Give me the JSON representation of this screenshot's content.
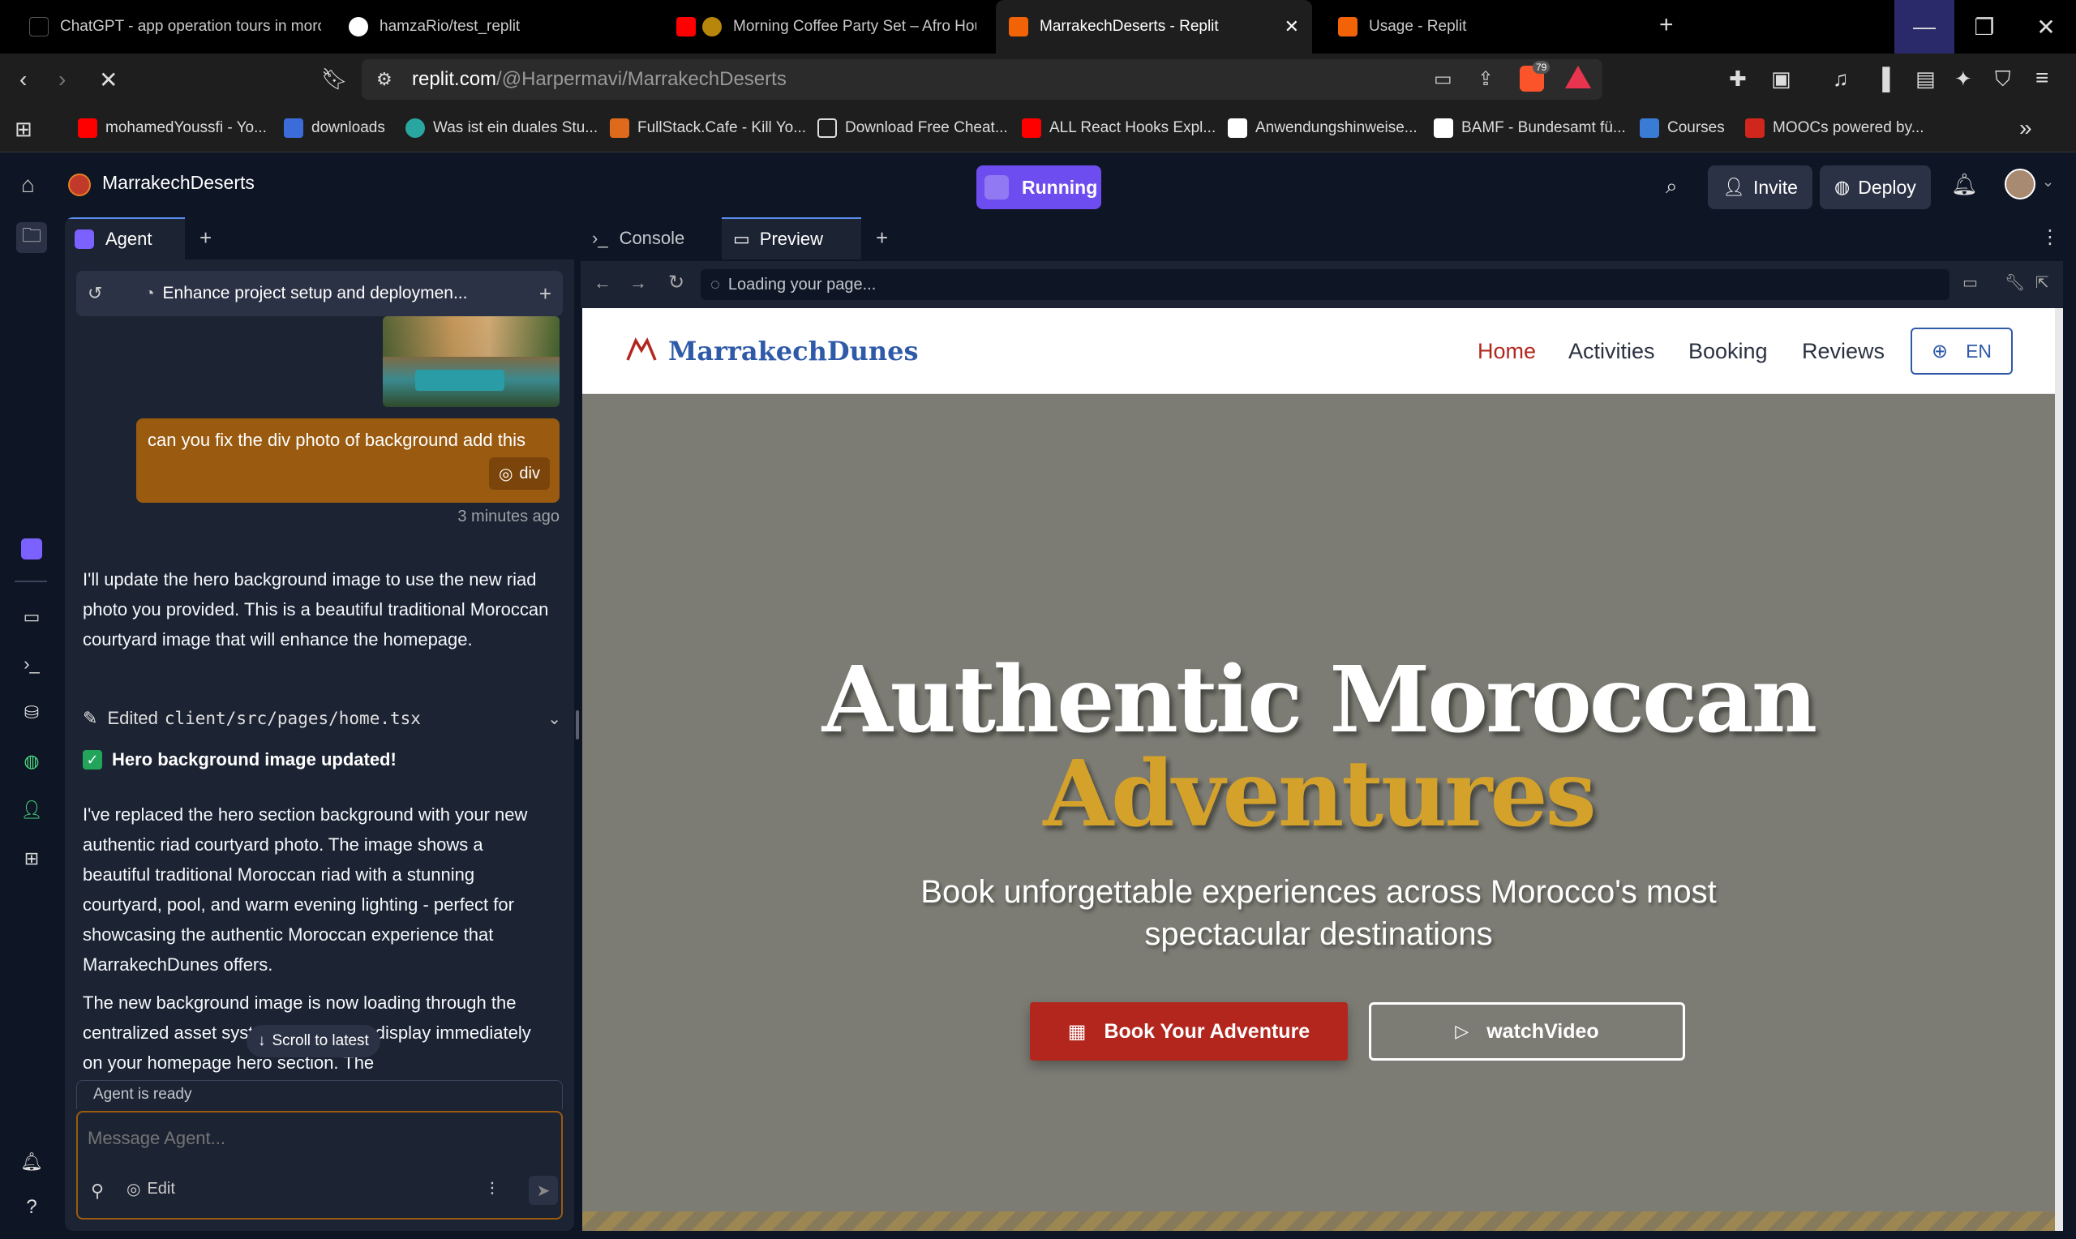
{
  "browser": {
    "tabs": [
      {
        "title": "ChatGPT - app operation tours in morocc",
        "color": "#000000"
      },
      {
        "title": "hamzaRio/test_replit",
        "color": "#ffffff"
      },
      {
        "title": "Morning Coffee Party Set – Afro Hou",
        "color": "#ff0000"
      },
      {
        "title": "MarrakechDeserts - Replit",
        "color": "#f26207"
      },
      {
        "title": "Usage - Replit",
        "color": "#f26207"
      }
    ],
    "url_host": "replit.com",
    "url_path": "/@Harpermavi/MarrakechDeserts",
    "shield_badge": "79",
    "bookmarks": [
      {
        "label": "mohamedYoussfi - Yo...",
        "color": "#ff0000"
      },
      {
        "label": "downloads",
        "color": "#3b6cd9"
      },
      {
        "label": "Was ist ein duales Stu...",
        "color": "#2aa6a1"
      },
      {
        "label": "FullStack.Cafe - Kill Yo...",
        "color": "#e06a1b"
      },
      {
        "label": "Download Free Cheat...",
        "color": "#dddddd"
      },
      {
        "label": "ALL React Hooks Expl...",
        "color": "#ff0000"
      },
      {
        "label": "Anwendungshinweise...",
        "color": "#ffffff"
      },
      {
        "label": "BAMF - Bundesamt fü...",
        "color": "#ffffff"
      },
      {
        "label": "Courses",
        "color": "#3a7bd5"
      },
      {
        "label": "MOOCs powered by...",
        "color": "#d0261c"
      }
    ]
  },
  "replit": {
    "project_name": "MarrakechDeserts",
    "status": "Running",
    "invite_label": "Invite",
    "deploy_label": "Deploy",
    "agent_tab": "Agent",
    "task_title": "Enhance project setup and deploymen...",
    "user_message": "can you fix the div photo of background add this",
    "user_chip": "div",
    "user_time": "3 minutes ago",
    "agent_msg_1": "I'll update the hero background image to use the new riad photo you provided. This is a beautiful traditional Moroccan courtyard image that will enhance the homepage.",
    "edited_label": "Edited",
    "edited_file": "client/src/pages/home.tsx",
    "check_title": "Hero background image updated!",
    "agent_msg_2": "I've replaced the hero section background with your new authentic riad courtyard photo. The image shows a beautiful traditional Moroccan riad with a stunning courtyard, pool, and warm evening lighting - perfect for showcasing the authentic Moroccan experience that MarrakechDunes offers.",
    "agent_msg_3": "The new background image is now loading through the centralized asset system and should display immediately on your homepage hero section. The",
    "scroll_latest": "Scroll to latest",
    "agent_status": "Agent is ready",
    "composer_placeholder": "Message Agent...",
    "edit_label": "Edit",
    "console_tab": "Console",
    "preview_tab": "Preview",
    "preview_url": "Loading your page...",
    "accent": "#6e4df0"
  },
  "site": {
    "brand": "MarrakechDunes",
    "nav": [
      "Home",
      "Activities",
      "Booking",
      "Reviews"
    ],
    "lang": "EN",
    "hero_title_1": "Authentic Moroccan",
    "hero_title_2": "Adventures",
    "hero_subtitle": "Book unforgettable experiences across Morocco's most spectacular destinations",
    "book_button": "Book Your Adventure",
    "watch_button": "watchVideo",
    "brand_color": "#2f5aa8",
    "accent_red": "#b3261e",
    "accent_gold": "#d4a22b"
  }
}
